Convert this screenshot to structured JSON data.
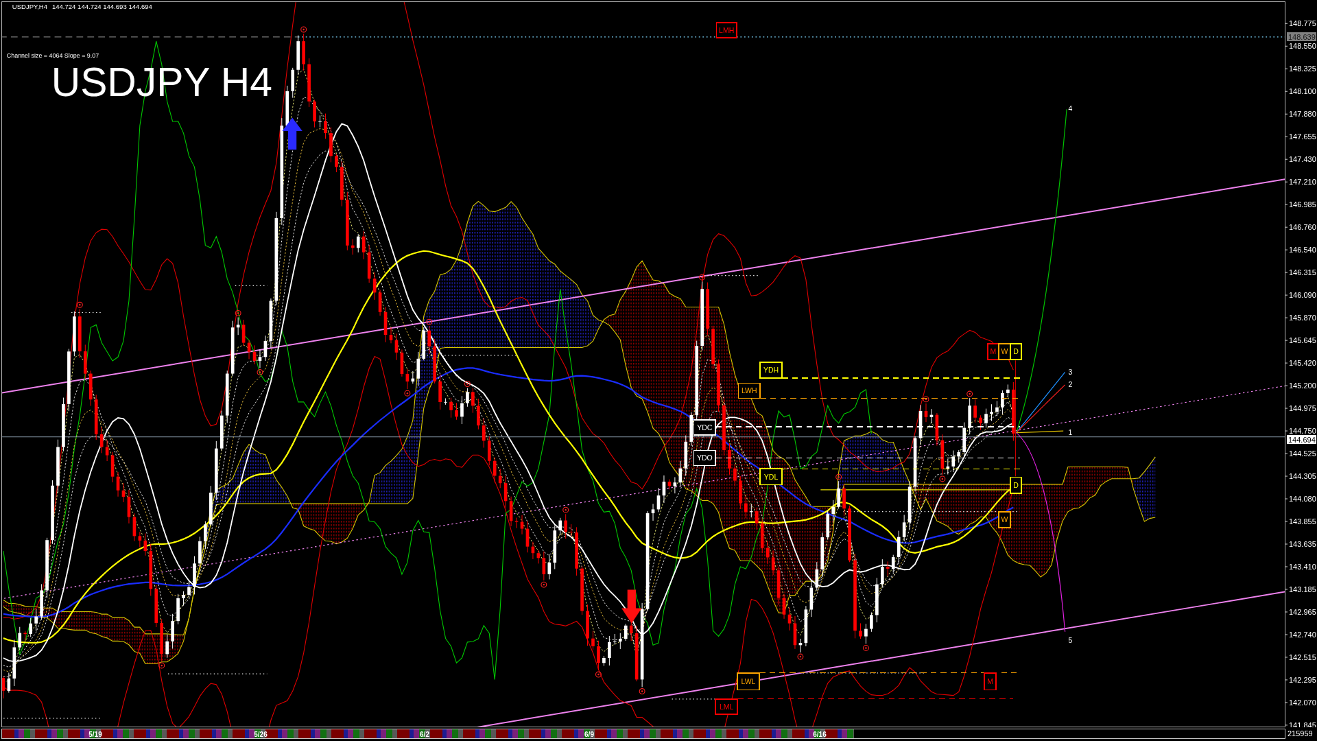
{
  "chart": {
    "symbol": "USDJPY,H4",
    "ohlc": "144.724 144.724 144.693 144.694",
    "channel_info": "Channel size = 4064 Slope = 9.07",
    "title": "USDJPY H4"
  },
  "level_labels": [
    {
      "text": "LMH",
      "color": "#ff0000"
    },
    {
      "text": "M",
      "color": "#ff0000"
    },
    {
      "text": "W",
      "color": "#ffa500"
    },
    {
      "text": "D",
      "color": "#ffff00"
    },
    {
      "text": "YDH",
      "color": "#ffff00"
    },
    {
      "text": "LWH",
      "color": "#ffa500"
    },
    {
      "text": "YDC",
      "color": "#ffffff"
    },
    {
      "text": "YDO",
      "color": "#ffffff"
    },
    {
      "text": "YDL",
      "color": "#ffff00"
    },
    {
      "text": "D",
      "color": "#ffff00"
    },
    {
      "text": "W",
      "color": "#ffa500"
    },
    {
      "text": "LWL",
      "color": "#ffa500"
    },
    {
      "text": "M",
      "color": "#ff0000"
    },
    {
      "text": "LML",
      "color": "#ff0000"
    }
  ],
  "projection_labels": [
    "4",
    "3",
    "2",
    "1",
    "5"
  ],
  "price_axis": {
    "ticks": [
      "148.775",
      "148.550",
      "148.325",
      "148.100",
      "147.880",
      "147.655",
      "147.430",
      "147.210",
      "146.985",
      "146.760",
      "146.540",
      "146.315",
      "146.090",
      "145.870",
      "145.645",
      "145.420",
      "145.200",
      "144.975",
      "144.750",
      "144.525",
      "144.305",
      "144.080",
      "143.855",
      "143.635",
      "143.410",
      "143.185",
      "142.965",
      "142.740",
      "142.515",
      "142.295",
      "142.070",
      "141.845"
    ],
    "tags": [
      {
        "text": "148.639",
        "kind": "marker"
      },
      {
        "text": "144.694",
        "kind": "bid"
      }
    ]
  },
  "time_axis": {
    "dates": [
      "5/19",
      "5/26",
      "6/2",
      "6/9",
      "6/16"
    ],
    "counter": "215959"
  }
}
